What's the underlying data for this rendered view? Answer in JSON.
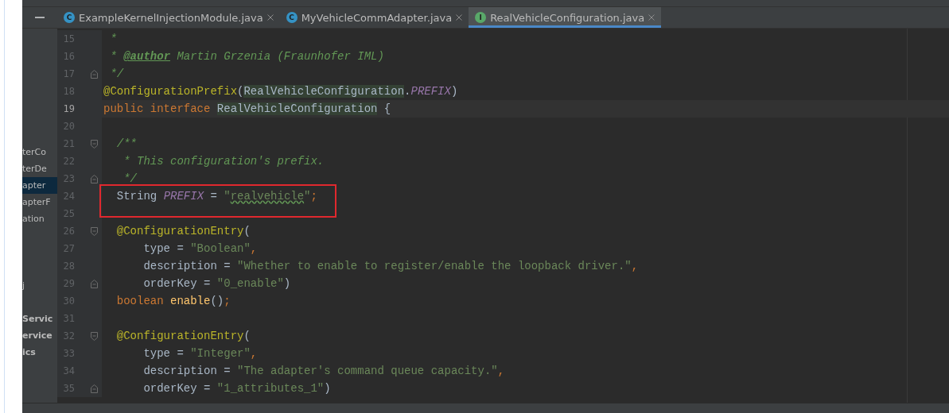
{
  "tabs": [
    {
      "label": "ExampleKernelInjectionModule.java",
      "icon_letter": "C",
      "kind": "class",
      "selected": false
    },
    {
      "label": "MyVehicleCommAdapter.java",
      "icon_letter": "C",
      "kind": "class",
      "selected": false
    },
    {
      "label": "RealVehicleConfiguration.java",
      "icon_letter": "I",
      "kind": "interface",
      "selected": true
    }
  ],
  "sidebar": {
    "groups": [
      {
        "items": [
          {
            "label": "terCo",
            "selected": false,
            "bold": false
          },
          {
            "label": "terDe",
            "selected": false,
            "bold": false
          },
          {
            "label": "apter",
            "selected": true,
            "bold": false
          },
          {
            "label": "apterF",
            "selected": false,
            "bold": false
          },
          {
            "label": "ation",
            "selected": false,
            "bold": false
          }
        ]
      },
      {
        "items": [
          {
            "label": "j",
            "selected": false,
            "bold": false
          }
        ]
      },
      {
        "items": [
          {
            "label": "Servic",
            "selected": false,
            "bold": true
          },
          {
            "label": "ervice",
            "selected": false,
            "bold": true
          },
          {
            "label": "ics",
            "selected": false,
            "bold": true
          }
        ]
      }
    ]
  },
  "editor": {
    "lines": [
      {
        "number": "15",
        "current": false,
        "boxed": false,
        "fold_start": false,
        "fold_end": false,
        "tokens": [
          {
            "text": " *",
            "kind": "comment"
          }
        ]
      },
      {
        "number": "16",
        "current": false,
        "boxed": false,
        "fold_start": false,
        "fold_end": false,
        "tokens": [
          {
            "text": " * ",
            "kind": "comment"
          },
          {
            "text": "@author",
            "kind": "doc-tag"
          },
          {
            "text": " Martin Grzenia (Fraunhofer IML)",
            "kind": "comment"
          }
        ]
      },
      {
        "number": "17",
        "current": false,
        "boxed": false,
        "fold_start": false,
        "fold_end": true,
        "tokens": [
          {
            "text": " */",
            "kind": "comment"
          }
        ]
      },
      {
        "number": "18",
        "current": false,
        "boxed": false,
        "fold_start": false,
        "fold_end": false,
        "tokens": [
          {
            "text": "@ConfigurationPrefix",
            "kind": "annotation"
          },
          {
            "text": "(",
            "kind": "plain"
          },
          {
            "text": "RealVehicleConfiguration",
            "kind": "usage"
          },
          {
            "text": ".",
            "kind": "plain"
          },
          {
            "text": "PREFIX",
            "kind": "constant"
          },
          {
            "text": ")",
            "kind": "plain"
          }
        ]
      },
      {
        "number": "19",
        "current": true,
        "boxed": false,
        "fold_start": false,
        "fold_end": false,
        "tokens": [
          {
            "text": "public interface ",
            "kind": "keyword"
          },
          {
            "text": "RealVehicleConfiguration",
            "kind": "usage"
          },
          {
            "text": " {",
            "kind": "plain"
          }
        ]
      },
      {
        "number": "20",
        "current": false,
        "boxed": false,
        "fold_start": false,
        "fold_end": false
      },
      {
        "number": "21",
        "current": false,
        "boxed": false,
        "fold_start": true,
        "fold_end": false,
        "tokens": [
          {
            "text": "  /**",
            "kind": "comment"
          }
        ]
      },
      {
        "number": "22",
        "current": false,
        "boxed": false,
        "fold_start": false,
        "fold_end": false,
        "tokens": [
          {
            "text": "   * This configuration's prefix.",
            "kind": "comment"
          }
        ]
      },
      {
        "number": "23",
        "current": false,
        "boxed": false,
        "fold_start": false,
        "fold_end": true,
        "tokens": [
          {
            "text": "   */",
            "kind": "comment"
          }
        ]
      },
      {
        "number": "24",
        "current": false,
        "boxed": true,
        "fold_start": false,
        "fold_end": false,
        "tokens": [
          {
            "text": "  String ",
            "kind": "plain"
          },
          {
            "text": "PREFIX",
            "kind": "constant"
          },
          {
            "text": " = ",
            "kind": "plain"
          },
          {
            "text": "\"",
            "kind": "string"
          },
          {
            "text": "realvehicle",
            "kind": "string-typo"
          },
          {
            "text": "\"",
            "kind": "string"
          },
          {
            "text": ";",
            "kind": "punct"
          }
        ]
      },
      {
        "number": "25",
        "current": false,
        "boxed": true,
        "fold_start": false,
        "fold_end": false
      },
      {
        "number": "26",
        "current": false,
        "boxed": false,
        "fold_start": true,
        "fold_end": false,
        "tokens": [
          {
            "text": "  @ConfigurationEntry",
            "kind": "annotation"
          },
          {
            "text": "(",
            "kind": "plain"
          }
        ]
      },
      {
        "number": "27",
        "current": false,
        "boxed": false,
        "fold_start": false,
        "fold_end": false,
        "tokens": [
          {
            "text": "      type = ",
            "kind": "plain"
          },
          {
            "text": "\"Boolean\"",
            "kind": "string"
          },
          {
            "text": ",",
            "kind": "punct"
          }
        ]
      },
      {
        "number": "28",
        "current": false,
        "boxed": false,
        "fold_start": false,
        "fold_end": false,
        "tokens": [
          {
            "text": "      description = ",
            "kind": "plain"
          },
          {
            "text": "\"Whether to enable to register/enable the loopback driver.\"",
            "kind": "string"
          },
          {
            "text": ",",
            "kind": "punct"
          }
        ]
      },
      {
        "number": "29",
        "current": false,
        "boxed": false,
        "fold_start": false,
        "fold_end": true,
        "tokens": [
          {
            "text": "      orderKey = ",
            "kind": "plain"
          },
          {
            "text": "\"0_enable\"",
            "kind": "string"
          },
          {
            "text": ")",
            "kind": "plain"
          }
        ]
      },
      {
        "number": "30",
        "current": false,
        "boxed": false,
        "fold_start": false,
        "fold_end": false,
        "tokens": [
          {
            "text": "  boolean ",
            "kind": "keyword"
          },
          {
            "text": "enable",
            "kind": "method"
          },
          {
            "text": "()",
            "kind": "plain"
          },
          {
            "text": ";",
            "kind": "punct"
          }
        ]
      },
      {
        "number": "31",
        "current": false,
        "boxed": false,
        "fold_start": false,
        "fold_end": false
      },
      {
        "number": "32",
        "current": false,
        "boxed": false,
        "fold_start": true,
        "fold_end": false,
        "tokens": [
          {
            "text": "  @ConfigurationEntry",
            "kind": "annotation"
          },
          {
            "text": "(",
            "kind": "plain"
          }
        ]
      },
      {
        "number": "33",
        "current": false,
        "boxed": false,
        "fold_start": false,
        "fold_end": false,
        "tokens": [
          {
            "text": "      type = ",
            "kind": "plain"
          },
          {
            "text": "\"Integer\"",
            "kind": "string"
          },
          {
            "text": ",",
            "kind": "punct"
          }
        ]
      },
      {
        "number": "34",
        "current": false,
        "boxed": false,
        "fold_start": false,
        "fold_end": false,
        "tokens": [
          {
            "text": "      description = ",
            "kind": "plain"
          },
          {
            "text": "\"The adapter's command queue capacity.\"",
            "kind": "string"
          },
          {
            "text": ",",
            "kind": "punct"
          }
        ]
      },
      {
        "number": "35",
        "current": false,
        "boxed": false,
        "fold_start": false,
        "fold_end": true,
        "tokens": [
          {
            "text": "      orderKey = ",
            "kind": "plain"
          },
          {
            "text": "\"1_attributes_1\"",
            "kind": "string"
          },
          {
            "text": ")",
            "kind": "plain"
          }
        ]
      }
    ]
  }
}
